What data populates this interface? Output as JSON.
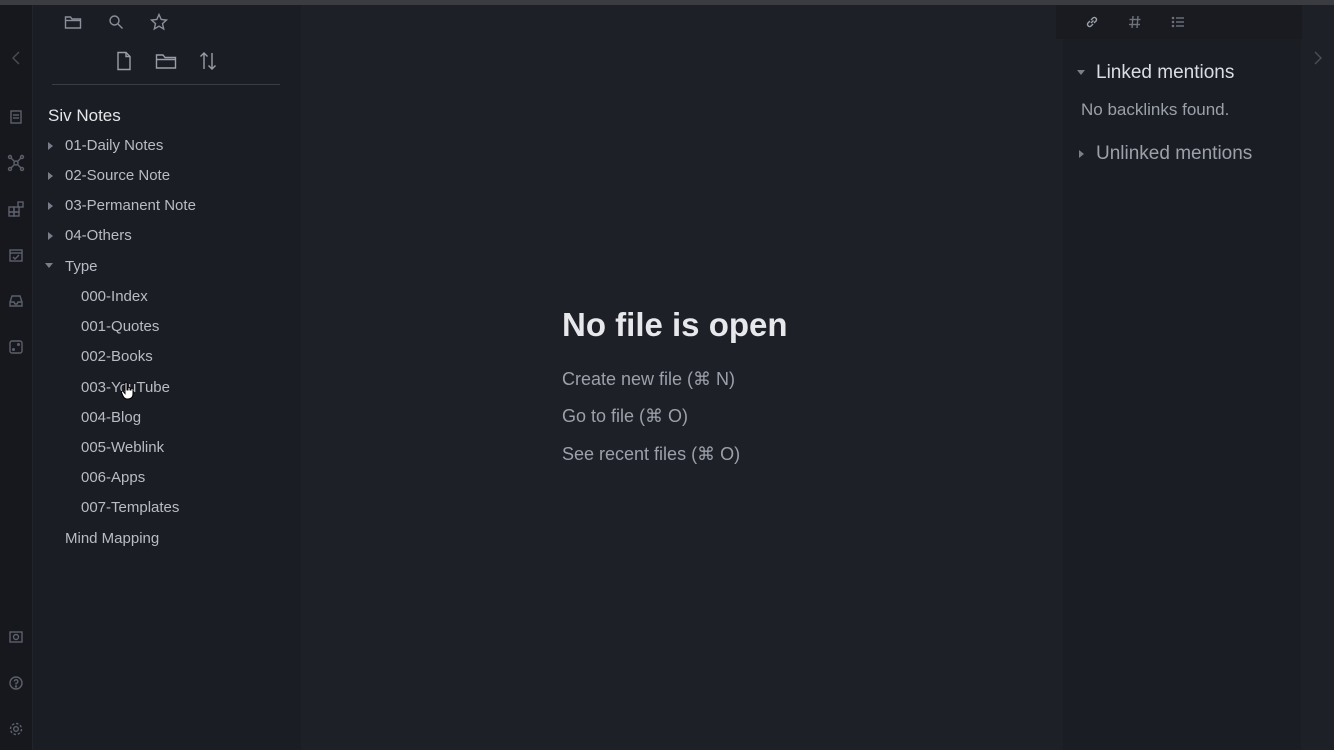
{
  "left_tabs": [
    {
      "icon": "folder-icon"
    },
    {
      "icon": "search-icon"
    },
    {
      "icon": "star-icon"
    }
  ],
  "file_tools": [
    {
      "icon": "new-note-icon"
    },
    {
      "icon": "new-folder-icon"
    },
    {
      "icon": "sort-icon"
    }
  ],
  "ribbon_icons": [
    "daily-note-icon",
    "graph-icon",
    "plugins-icon",
    "calendar-icon",
    "inbox-icon",
    "dice-icon",
    "vault-icon",
    "help-icon",
    "settings-icon"
  ],
  "vault_name": "Siv Notes",
  "tree": [
    {
      "label": "01-Daily Notes",
      "collapsed": true
    },
    {
      "label": "02-Source Note",
      "collapsed": true
    },
    {
      "label": "03-Permanent Note",
      "collapsed": true
    },
    {
      "label": "04-Others",
      "collapsed": true
    },
    {
      "label": "Type",
      "collapsed": false
    },
    {
      "label": "000-Index"
    },
    {
      "label": "001-Quotes"
    },
    {
      "label": "002-Books"
    },
    {
      "label": "003-YouTube"
    },
    {
      "label": "004-Blog"
    },
    {
      "label": "005-Weblink"
    },
    {
      "label": "006-Apps"
    },
    {
      "label": "007-Templates"
    },
    {
      "label": "Mind Mapping"
    }
  ],
  "main": {
    "title": "No file is open",
    "actions": [
      "Create new file (⌘ N)",
      "Go to file (⌘ O)",
      "See recent files (⌘ O)"
    ]
  },
  "right_tabs": [
    {
      "icon": "link-icon"
    },
    {
      "icon": "hash-icon"
    },
    {
      "icon": "list-icon"
    }
  ],
  "backlinks": {
    "linked_header": "Linked mentions",
    "no_backlinks": "No backlinks found.",
    "unlinked_header": "Unlinked mentions"
  }
}
